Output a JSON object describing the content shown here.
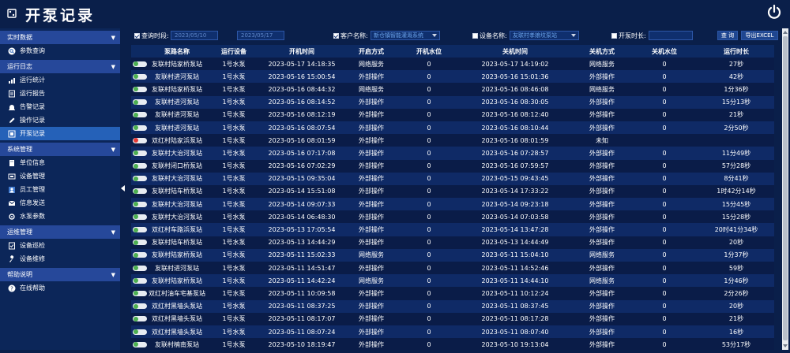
{
  "app": {
    "title": "开泵记录"
  },
  "sidebar": {
    "sections": [
      {
        "label": "实时数据",
        "items": [
          {
            "label": "参数查询",
            "icon": "search-icon"
          }
        ]
      },
      {
        "label": "运行日志",
        "items": [
          {
            "label": "运行统计",
            "icon": "chart-icon"
          },
          {
            "label": "运行报告",
            "icon": "report-icon"
          },
          {
            "label": "告警记录",
            "icon": "alarm-icon"
          },
          {
            "label": "操作记录",
            "icon": "edit-icon"
          },
          {
            "label": "开泵记录",
            "icon": "pump-icon",
            "active": true
          }
        ]
      },
      {
        "label": "系统管理",
        "items": [
          {
            "label": "单位信息",
            "icon": "building-icon"
          },
          {
            "label": "设备管理",
            "icon": "device-icon"
          },
          {
            "label": "员工管理",
            "icon": "staff-icon"
          },
          {
            "label": "信息发送",
            "icon": "send-icon"
          },
          {
            "label": "水泵参数",
            "icon": "pump-param-icon"
          }
        ]
      },
      {
        "label": "运维管理",
        "items": [
          {
            "label": "设备巡检",
            "icon": "inspect-icon"
          },
          {
            "label": "设备维修",
            "icon": "repair-icon"
          }
        ]
      },
      {
        "label": "帮助说明",
        "items": [
          {
            "label": "在线帮助",
            "icon": "help-icon"
          }
        ]
      }
    ]
  },
  "filter": {
    "query_time_label": "查询时段:",
    "date_start": "2023/05/10",
    "date_end": "2023/05/17",
    "customer_label": "客户名称:",
    "customer_value": "新仓镇智能灌溉系统",
    "device_label": "设备名称:",
    "device_value": "友联村孝娘坟泵站",
    "duration_label": "开泵时长:",
    "query_button": "查 询",
    "export_button": "导出EXCEL"
  },
  "table": {
    "headers": [
      "泵路名称",
      "运行设备",
      "开机时间",
      "开启方式",
      "开机水位",
      "关机时间",
      "关机方式",
      "关机水位",
      "运行时长"
    ],
    "rows": [
      {
        "on": true,
        "name": "友联村陆家桥泵站",
        "device": "1号水泵",
        "start": "2023-05-17 14:18:35",
        "start_mode": "网络服务",
        "start_level": "0",
        "stop": "2023-05-17 14:19:02",
        "stop_mode": "网络服务",
        "stop_level": "0",
        "duration": "27秒"
      },
      {
        "on": true,
        "name": "友联村进河泵站",
        "device": "1号水泵",
        "start": "2023-05-16 15:00:54",
        "start_mode": "外部操作",
        "start_level": "0",
        "stop": "2023-05-16 15:01:36",
        "stop_mode": "外部操作",
        "stop_level": "0",
        "duration": "42秒"
      },
      {
        "on": true,
        "name": "友联村陆家桥泵站",
        "device": "1号水泵",
        "start": "2023-05-16 08:44:32",
        "start_mode": "网络服务",
        "start_level": "0",
        "stop": "2023-05-16 08:46:08",
        "stop_mode": "网络服务",
        "stop_level": "0",
        "duration": "1分36秒"
      },
      {
        "on": true,
        "name": "友联村进河泵站",
        "device": "1号水泵",
        "start": "2023-05-16 08:14:52",
        "start_mode": "外部操作",
        "start_level": "0",
        "stop": "2023-05-16 08:30:05",
        "stop_mode": "外部操作",
        "stop_level": "0",
        "duration": "15分13秒"
      },
      {
        "on": true,
        "name": "友联村进河泵站",
        "device": "1号水泵",
        "start": "2023-05-16 08:12:19",
        "start_mode": "外部操作",
        "start_level": "0",
        "stop": "2023-05-16 08:12:40",
        "stop_mode": "外部操作",
        "stop_level": "0",
        "duration": "21秒"
      },
      {
        "on": true,
        "name": "友联村进河泵站",
        "device": "1号水泵",
        "start": "2023-05-16 08:07:54",
        "start_mode": "外部操作",
        "start_level": "0",
        "stop": "2023-05-16 08:10:44",
        "stop_mode": "外部操作",
        "stop_level": "0",
        "duration": "2分50秒"
      },
      {
        "on": false,
        "name": "双红村陆家浜泵站",
        "device": "1号水泵",
        "start": "2023-05-16 08:01:59",
        "start_mode": "外部操作",
        "start_level": "0",
        "stop": "2023-05-16 08:01:59",
        "stop_mode": "未知",
        "stop_level": "",
        "duration": ""
      },
      {
        "on": true,
        "name": "友联村大治河泵站",
        "device": "1号水泵",
        "start": "2023-05-16 07:17:08",
        "start_mode": "外部操作",
        "start_level": "0",
        "stop": "2023-05-16 07:28:57",
        "stop_mode": "外部操作",
        "stop_level": "0",
        "duration": "11分49秒"
      },
      {
        "on": true,
        "name": "友联村闭口桥泵站",
        "device": "1号水泵",
        "start": "2023-05-16 07:02:29",
        "start_mode": "外部操作",
        "start_level": "0",
        "stop": "2023-05-16 07:59:57",
        "stop_mode": "外部操作",
        "stop_level": "0",
        "duration": "57分28秒"
      },
      {
        "on": true,
        "name": "友联村大治河泵站",
        "device": "1号水泵",
        "start": "2023-05-15 09:35:04",
        "start_mode": "外部操作",
        "start_level": "0",
        "stop": "2023-05-15 09:43:45",
        "stop_mode": "外部操作",
        "stop_level": "0",
        "duration": "8分41秒"
      },
      {
        "on": true,
        "name": "友联村陆车桥泵站",
        "device": "1号水泵",
        "start": "2023-05-14 15:51:08",
        "start_mode": "外部操作",
        "start_level": "0",
        "stop": "2023-05-14 17:33:22",
        "stop_mode": "外部操作",
        "stop_level": "0",
        "duration": "1时42分14秒"
      },
      {
        "on": true,
        "name": "友联村大治河泵站",
        "device": "1号水泵",
        "start": "2023-05-14 09:07:33",
        "start_mode": "外部操作",
        "start_level": "0",
        "stop": "2023-05-14 09:23:18",
        "stop_mode": "外部操作",
        "stop_level": "0",
        "duration": "15分45秒"
      },
      {
        "on": true,
        "name": "友联村大治河泵站",
        "device": "1号水泵",
        "start": "2023-05-14 06:48:30",
        "start_mode": "外部操作",
        "start_level": "0",
        "stop": "2023-05-14 07:03:58",
        "stop_mode": "外部操作",
        "stop_level": "0",
        "duration": "15分28秒"
      },
      {
        "on": true,
        "name": "双红村车路浜泵站",
        "device": "1号水泵",
        "start": "2023-05-13 17:05:54",
        "start_mode": "外部操作",
        "start_level": "0",
        "stop": "2023-05-14 13:47:28",
        "stop_mode": "外部操作",
        "stop_level": "0",
        "duration": "20时41分34秒"
      },
      {
        "on": true,
        "name": "友联村陆车桥泵站",
        "device": "1号水泵",
        "start": "2023-05-13 14:44:29",
        "start_mode": "外部操作",
        "start_level": "0",
        "stop": "2023-05-13 14:44:49",
        "stop_mode": "外部操作",
        "stop_level": "0",
        "duration": "20秒"
      },
      {
        "on": true,
        "name": "友联村陆家桥泵站",
        "device": "1号水泵",
        "start": "2023-05-11 15:02:33",
        "start_mode": "网络服务",
        "start_level": "0",
        "stop": "2023-05-11 15:04:10",
        "stop_mode": "网络服务",
        "stop_level": "0",
        "duration": "1分37秒"
      },
      {
        "on": true,
        "name": "友联村进河泵站",
        "device": "1号水泵",
        "start": "2023-05-11 14:51:47",
        "start_mode": "外部操作",
        "start_level": "0",
        "stop": "2023-05-11 14:52:46",
        "stop_mode": "外部操作",
        "stop_level": "0",
        "duration": "59秒"
      },
      {
        "on": true,
        "name": "友联村陆家桥泵站",
        "device": "1号水泵",
        "start": "2023-05-11 14:42:24",
        "start_mode": "网络服务",
        "start_level": "0",
        "stop": "2023-05-11 14:44:10",
        "stop_mode": "网络服务",
        "stop_level": "0",
        "duration": "1分46秒"
      },
      {
        "on": true,
        "name": "双红村油车宅基泵站",
        "device": "1号水泵",
        "start": "2023-05-11 10:09:58",
        "start_mode": "外部操作",
        "start_level": "0",
        "stop": "2023-05-11 10:12:24",
        "stop_mode": "外部操作",
        "stop_level": "0",
        "duration": "2分26秒"
      },
      {
        "on": true,
        "name": "双红村黑墙头泵站",
        "device": "1号水泵",
        "start": "2023-05-11 08:37:25",
        "start_mode": "外部操作",
        "start_level": "0",
        "stop": "2023-05-11 08:37:45",
        "stop_mode": "外部操作",
        "stop_level": "0",
        "duration": "20秒"
      },
      {
        "on": true,
        "name": "双红村黑墙头泵站",
        "device": "1号水泵",
        "start": "2023-05-11 08:17:07",
        "start_mode": "外部操作",
        "start_level": "0",
        "stop": "2023-05-11 08:17:28",
        "stop_mode": "外部操作",
        "stop_level": "0",
        "duration": "21秒"
      },
      {
        "on": true,
        "name": "双红村黑墙头泵站",
        "device": "1号水泵",
        "start": "2023-05-11 08:07:24",
        "start_mode": "外部操作",
        "start_level": "0",
        "stop": "2023-05-11 08:07:40",
        "stop_mode": "外部操作",
        "stop_level": "0",
        "duration": "16秒"
      },
      {
        "on": true,
        "name": "友联村楠南泵站",
        "device": "1号水泵",
        "start": "2023-05-10 18:19:47",
        "start_mode": "外部操作",
        "start_level": "0",
        "stop": "2023-05-10 19:13:04",
        "stop_mode": "外部操作",
        "stop_level": "0",
        "duration": "53分17秒"
      }
    ]
  },
  "colors": {
    "background": "#0a1f4a",
    "sidebar": "#0c2659",
    "section_header": "#26489a",
    "active_item": "#2561b8",
    "row_odd": "#0a1c48",
    "row_even": "#0f2a66",
    "toggle_on": "#4caf50",
    "toggle_off": "#e53935"
  }
}
